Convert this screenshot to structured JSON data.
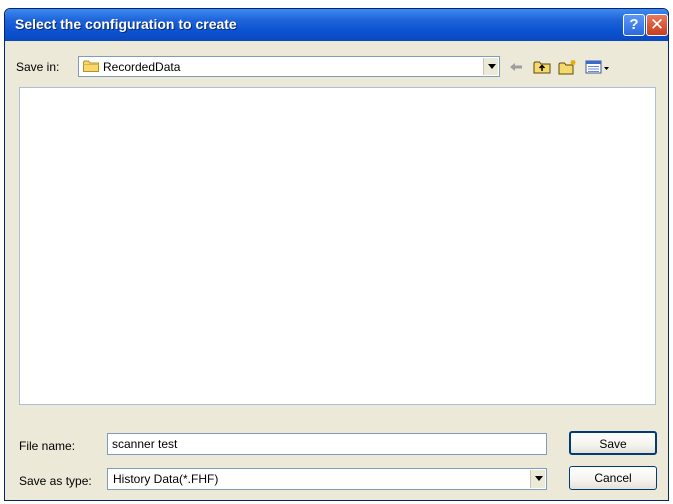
{
  "window": {
    "title": "Select the configuration to create",
    "help_button": "?",
    "close_button": "✕"
  },
  "save_in": {
    "label": "Save in:",
    "value": "RecordedData",
    "icon": "folder-icon"
  },
  "toolbar": {
    "icons": [
      "back-arrow-icon",
      "up-one-level-icon",
      "create-new-folder-icon",
      "view-menu-icon"
    ]
  },
  "file_name": {
    "label": "File name:",
    "value": "scanner test"
  },
  "save_as_type": {
    "label": "Save as type:",
    "value": "History Data(*.FHF)"
  },
  "buttons": {
    "save": "Save",
    "cancel": "Cancel"
  }
}
